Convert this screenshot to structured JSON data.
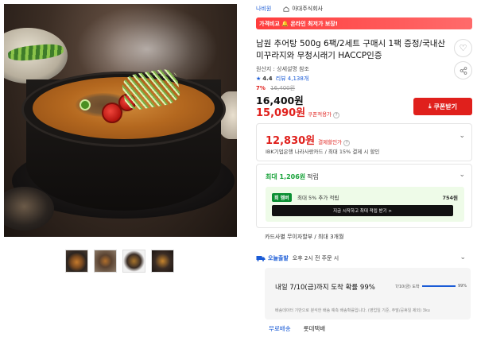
{
  "header": {
    "seller": "나비원",
    "store": "아대주식회사"
  },
  "promo": {
    "text": "가격비교 🔔 온라인 최저가 보장!"
  },
  "product": {
    "title": "남원 추어탕 500g 6팩/2세트 구매시 1팩 증정/국내산 미꾸라지와 무청시래기 HACCP인증",
    "origin": "원산지 : 상세설명 참조",
    "rating": "4.4",
    "review_count": "리뷰 4,138개",
    "discount_pct": "7%",
    "original_price": "16,400원",
    "sale_price": "16,400원",
    "coupon_price": "15,090원",
    "coupon_price_label": "쿠폰적용가",
    "coupon_button": "쿠폰받기"
  },
  "card_benefit": {
    "price": "12,830원",
    "label": "결제할인가",
    "description": "IBK기업은행 나라사랑카드 / 최대 15% 결제 시 할인"
  },
  "points": {
    "title": "최대 1,206원",
    "title_suffix": "적립",
    "badge": "회 멤버",
    "badge_text": "최대 5% 추가 적립",
    "badge_points": "754원",
    "subscribe_button": "지금 시작하고 최대 적립 받기 >"
  },
  "installment": "카드사별 무이자할부 / 최대 3개월",
  "delivery": {
    "brand": "오늘출발",
    "condition": "오후 2시 전 주문 시",
    "arrival": "내일 7/10(금)까지 도착 확률 99%",
    "arrival_day": "7/10(금) 도착",
    "arrival_pct": "99%",
    "arrival_fill": 0.99,
    "note": "배송데이터 기반으로 분석한 배송 예측 배송확률입니다. (영업일 기준, 주말/공휴일 제외) 3ku"
  },
  "bottom": {
    "free_shipping": "무료배송",
    "carrier": "롯데택배"
  },
  "icons": {
    "heart": "heart-icon",
    "share": "share-icon",
    "download": "download-icon",
    "chevron": "chevron-down-icon",
    "truck": "truck-icon",
    "home": "home-icon"
  },
  "colors": {
    "accent_red": "#e0201c",
    "brand_blue": "#1a5bd6",
    "points_green": "#19a33a"
  }
}
